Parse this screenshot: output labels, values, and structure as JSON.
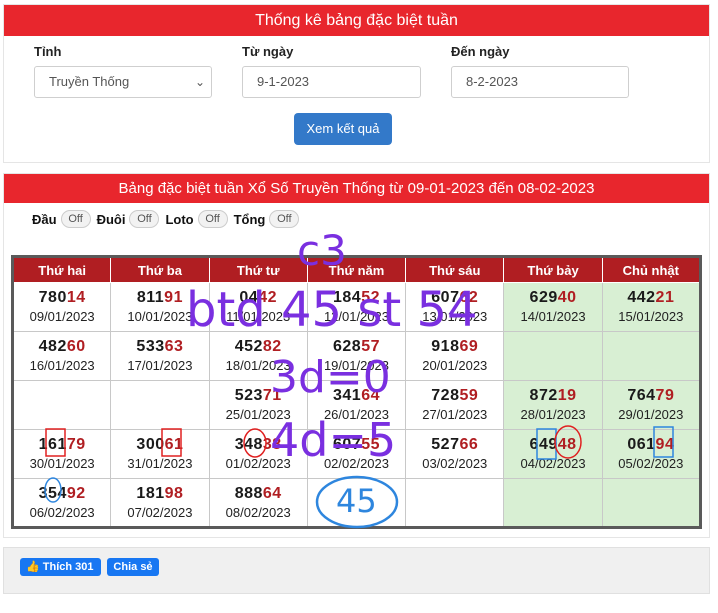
{
  "panel1": {
    "title": "Thống kê bảng đặc biệt tuần",
    "province_label": "Tỉnh",
    "province_value": "Truyền Thống",
    "from_label": "Từ ngày",
    "from_value": "9-1-2023",
    "to_label": "Đến ngày",
    "to_value": "8-2-2023",
    "submit_label": "Xem kết quả"
  },
  "panel2": {
    "title": "Bảng đặc biệt tuần Xổ Số Truyền Thống từ 09-01-2023 đến 08-02-2023",
    "toggles": [
      {
        "label": "Đầu",
        "state": "Off"
      },
      {
        "label": "Đuôi",
        "state": "Off"
      },
      {
        "label": "Loto",
        "state": "Off"
      },
      {
        "label": "Tổng",
        "state": "Off"
      }
    ],
    "headers": [
      "Thứ hai",
      "Thứ ba",
      "Thứ tư",
      "Thứ năm",
      "Thứ sáu",
      "Thứ bảy",
      "Chủ nhật"
    ],
    "rows": [
      [
        {
          "pre": "780",
          "hl": "14",
          "date": "09/01/2023"
        },
        {
          "pre": "811",
          "hl": "91",
          "date": "10/01/2023"
        },
        {
          "pre": "04",
          "hl": "42",
          "date": "11/01/2023"
        },
        {
          "pre": "184",
          "hl": "52",
          "date": "12/01/2023"
        },
        {
          "pre": "607",
          "hl": "62",
          "date": "13/01/2023"
        },
        {
          "pre": "629",
          "hl": "40",
          "date": "14/01/2023"
        },
        {
          "pre": "442",
          "hl": "21",
          "date": "15/01/2023"
        }
      ],
      [
        {
          "pre": "482",
          "hl": "60",
          "date": "16/01/2023"
        },
        {
          "pre": "533",
          "hl": "63",
          "date": "17/01/2023"
        },
        {
          "pre": "452",
          "hl": "82",
          "date": "18/01/2023"
        },
        {
          "pre": "628",
          "hl": "57",
          "date": "19/01/2023"
        },
        {
          "pre": "918",
          "hl": "69",
          "date": "20/01/2023"
        },
        {
          "pre": "",
          "hl": "",
          "date": ""
        },
        {
          "pre": "",
          "hl": "",
          "date": ""
        }
      ],
      [
        {
          "pre": "",
          "hl": "",
          "date": ""
        },
        {
          "pre": "",
          "hl": "",
          "date": ""
        },
        {
          "pre": "523",
          "hl": "71",
          "date": "25/01/2023"
        },
        {
          "pre": "341",
          "hl": "64",
          "date": "26/01/2023"
        },
        {
          "pre": "728",
          "hl": "59",
          "date": "27/01/2023"
        },
        {
          "pre": "872",
          "hl": "19",
          "date": "28/01/2023"
        },
        {
          "pre": "764",
          "hl": "79",
          "date": "29/01/2023"
        }
      ],
      [
        {
          "pre": "161",
          "hl": "79",
          "date": "30/01/2023"
        },
        {
          "pre": "300",
          "hl": "61",
          "date": "31/01/2023"
        },
        {
          "pre": "348",
          "hl": "38",
          "date": "01/02/2023"
        },
        {
          "pre": "607",
          "hl": "55",
          "date": "02/02/2023"
        },
        {
          "pre": "527",
          "hl": "66",
          "date": "03/02/2023"
        },
        {
          "pre": "649",
          "hl": "48",
          "date": "04/02/2023"
        },
        {
          "pre": "061",
          "hl": "94",
          "date": "05/02/2023"
        }
      ],
      [
        {
          "pre": "354",
          "hl": "92",
          "date": "06/02/2023"
        },
        {
          "pre": "181",
          "hl": "98",
          "date": "07/02/2023"
        },
        {
          "pre": "888",
          "hl": "64",
          "date": "08/02/2023"
        },
        {
          "pre": "",
          "hl": "",
          "date": ""
        },
        {
          "pre": "",
          "hl": "",
          "date": ""
        },
        {
          "pre": "",
          "hl": "",
          "date": ""
        },
        {
          "pre": "",
          "hl": "",
          "date": ""
        }
      ]
    ]
  },
  "footer": {
    "like_label": "Thích 301",
    "share_label": "Chia sẻ"
  },
  "overlay": {
    "line1": "c3",
    "line2": "btd 45 st 54",
    "line3": "3d=0",
    "line4": "4d=5",
    "circled": "45"
  },
  "colors": {
    "header_red": "#e8262d",
    "table_head_red": "#b01e22",
    "weekend_green": "#d8efd3",
    "button_blue": "#3379c9",
    "ink_purple": "#7a2fe0",
    "ink_blue": "#2e86de",
    "ink_red": "#e02020"
  }
}
